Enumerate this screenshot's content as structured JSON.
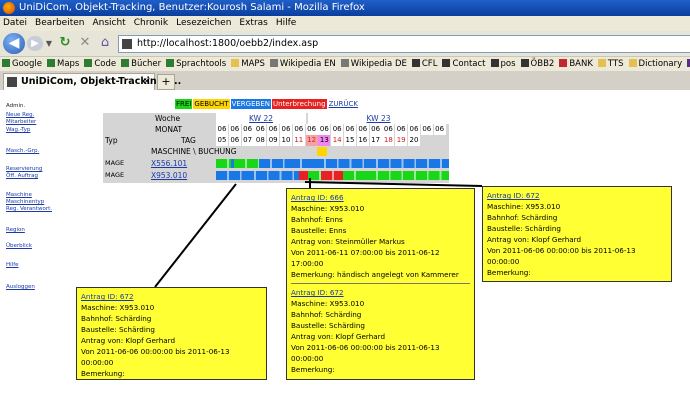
{
  "window": {
    "title": "UniDiCom, Objekt-Tracking, Benutzer:Kourosh Salami - Mozilla Firefox"
  },
  "menu": [
    "Datei",
    "Bearbeiten",
    "Ansicht",
    "Chronik",
    "Lesezeichen",
    "Extras",
    "Hilfe"
  ],
  "nav": {
    "url": "http://localhost:1800/oebb2/index.asp"
  },
  "bookmarks": [
    {
      "label": "Google",
      "color": "#2f7d32"
    },
    {
      "label": "Maps",
      "color": "#2f7d32"
    },
    {
      "label": "Code",
      "color": "#2f7d32"
    },
    {
      "label": "Bücher",
      "color": "#2f7d32"
    },
    {
      "label": "Sprachtools",
      "color": "#2f7d32"
    },
    {
      "label": "MAPS",
      "color": "#e4c050"
    },
    {
      "label": "Wikipedia EN",
      "color": "#777777"
    },
    {
      "label": "Wikipedia DE",
      "color": "#777777"
    },
    {
      "label": "CFL",
      "color": "#333333"
    },
    {
      "label": "Contact",
      "color": "#333333"
    },
    {
      "label": "pos",
      "color": "#333333"
    },
    {
      "label": "ÖBB2",
      "color": "#333333"
    },
    {
      "label": "BANK",
      "color": "#c0282d"
    },
    {
      "label": "TTS",
      "color": "#e4c050"
    },
    {
      "label": "Dictionary",
      "color": "#e4c050"
    },
    {
      "label": "Y",
      "color": "#5b2b87"
    }
  ],
  "tab": {
    "title": "UniDiCom, Objekt-Tracking, ...",
    "close": "×",
    "new": "+"
  },
  "sidebar": {
    "admin": "Admin.",
    "groups": [
      [
        "Neue Reg.",
        "Mitarbeiter",
        "Wag.-Typ"
      ],
      [
        "Masch.-Grp."
      ],
      [
        "Reservierung",
        "Öff. Auftrag"
      ],
      [
        "Maschine",
        "Maschinentyp",
        "Reg. Verantwort."
      ],
      [
        "Region"
      ],
      [
        "Überblick"
      ],
      [
        "Hilfe"
      ],
      [
        "Ausloggen"
      ]
    ]
  },
  "legend": {
    "frei": "FREI",
    "gebucht": "GEBUCHT",
    "vergeben": "VERGEBEN",
    "unterbrechung": "Unterbrechung",
    "zurueck": "ZURÜCK"
  },
  "plan": {
    "labels": {
      "woche": "Woche",
      "monat": "MONAT",
      "typ": "Typ",
      "tag": "TAG",
      "maschine": "MASCHINE \\ BUCHUNG"
    },
    "weeks": [
      "KW 22",
      "KW 23"
    ],
    "monat": [
      "06",
      "06",
      "06",
      "06",
      "06",
      "06",
      "06",
      "06",
      "06",
      "06",
      "06",
      "06",
      "06",
      "06",
      "06",
      "06",
      "06",
      "06"
    ],
    "days": [
      "05",
      "06",
      "07",
      "08",
      "09",
      "10",
      "11",
      "12",
      "13",
      "14",
      "15",
      "16",
      "17",
      "18",
      "19",
      "20"
    ],
    "rows": [
      {
        "typ": "MAGE",
        "machine": "X556.101"
      },
      {
        "typ": "MAGE",
        "machine": "X953.010"
      }
    ],
    "colors": {
      "frei": "#19d619",
      "vergeben": "#1a78e6",
      "unterbrechung": "#e82222",
      "gebucht": "#ffd500",
      "weekend": "#f4a2a2",
      "today": "#ee88ee"
    }
  },
  "popups": [
    {
      "lines": [
        "Antrag ID: 672",
        "Maschine: X953.010",
        "Bahnhof: Schärding",
        "Baustelle: Schärding",
        "Antrag von: Klopf Gerhard",
        "Von 2011-06-06 00:00:00 bis 2011-06-13",
        "00:00:00",
        "Bemerkung:"
      ]
    },
    {
      "lines": [
        "Antrag ID: 666",
        "Maschine: X953.010",
        "Bahnhof: Enns",
        "Baustelle: Enns",
        "Antrag von: Steinmüller Markus",
        "Von 2011-06-11 07:00:00 bis 2011-06-12",
        "17:00:00",
        "Bemerkung: händisch angelegt von Kammerer"
      ]
    },
    {
      "lines": [
        "Antrag ID: 672",
        "Maschine: X953.010",
        "Bahnhof: Schärding",
        "Baustelle: Schärding",
        "Antrag von: Klopf Gerhard",
        "Von 2011-06-06 00:00:00 bis 2011-06-13",
        "00:00:00",
        "Bemerkung:"
      ]
    },
    {
      "lines": [
        "Antrag ID: 672",
        "Maschine: X953.010",
        "Bahnhof: Schärding",
        "Baustelle: Schärding",
        "Antrag von: Klopf Gerhard",
        "Von 2011-06-06 00:00:00 bis 2011-06-13",
        "00:00:00",
        "Bemerkung:"
      ]
    }
  ]
}
